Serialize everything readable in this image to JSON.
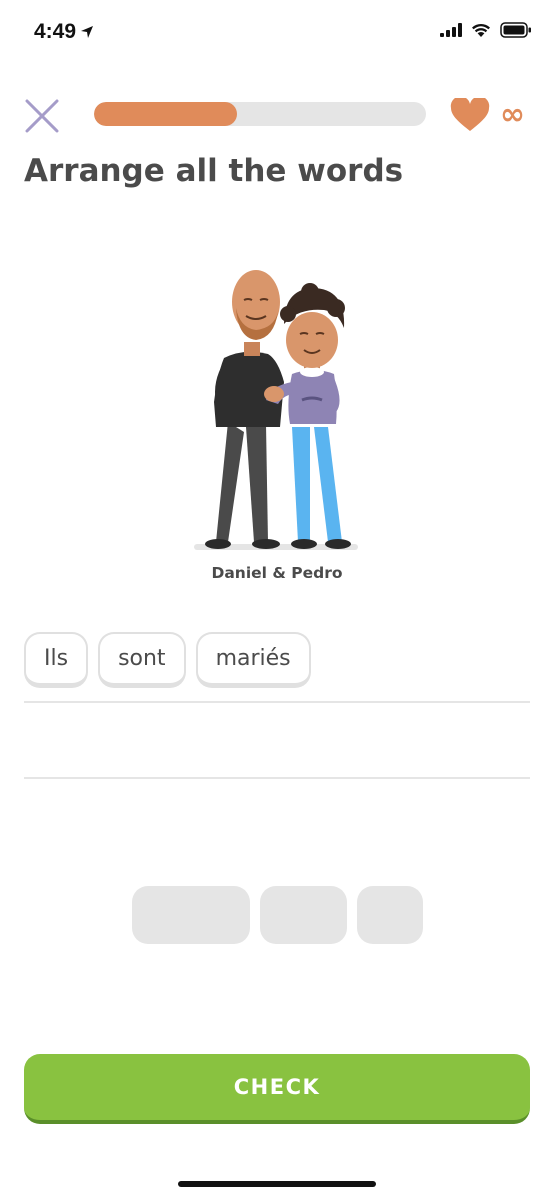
{
  "status_bar": {
    "time": "4:49",
    "icons": [
      "location-arrow-icon",
      "cellular-signal-icon",
      "wifi-icon",
      "battery-icon"
    ]
  },
  "header": {
    "close_icon": "close-icon",
    "progress_fraction": 0.43,
    "progress_color": "#e08b5a",
    "heart_icon": "heart-icon",
    "lives": "∞",
    "lives_color": "#e08b5a"
  },
  "exercise": {
    "title": "Arrange all the words",
    "caption": "Daniel & Pedro"
  },
  "answer": {
    "words": [
      "Ils",
      "sont",
      "mariés"
    ]
  },
  "bank": {
    "empty_slots": 3
  },
  "check_button": {
    "label": "CHECK",
    "color": "#89c240"
  }
}
